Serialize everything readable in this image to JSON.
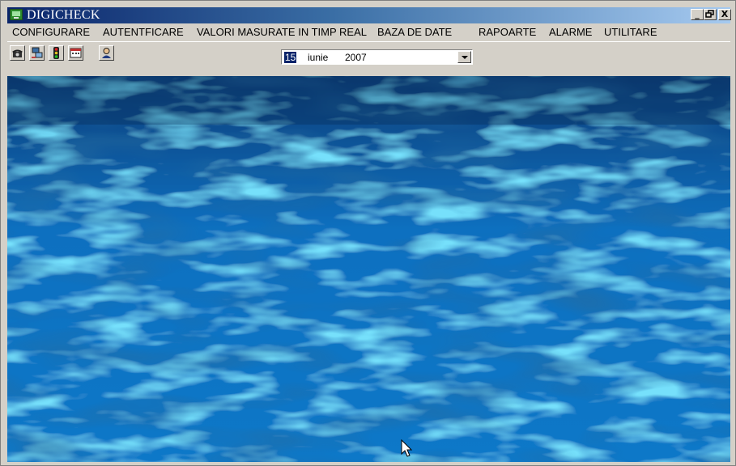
{
  "window": {
    "title": "DIGICHECK",
    "minimize_label": "_",
    "restore_label": "▫",
    "close_label": "X"
  },
  "menu": {
    "items": [
      "CONFIGURARE",
      "AUTENTFICARE",
      "VALORI MASURATE IN TIMP REAL",
      "BAZA DE DATE",
      "RAPOARTE",
      "ALARME",
      "UTILITARE"
    ]
  },
  "toolbar": {
    "icons": [
      "phone-icon",
      "computer-network-icon",
      "traffic-light-icon",
      "calendar-icon",
      "user-icon"
    ]
  },
  "date_picker": {
    "day": "15",
    "month": "iunie",
    "year": "2007"
  },
  "colors": {
    "titlebar_start": "#0a246a",
    "titlebar_end": "#a6caf0",
    "water_deep": "#0b3f7a",
    "water_light": "#2fb8f0"
  }
}
